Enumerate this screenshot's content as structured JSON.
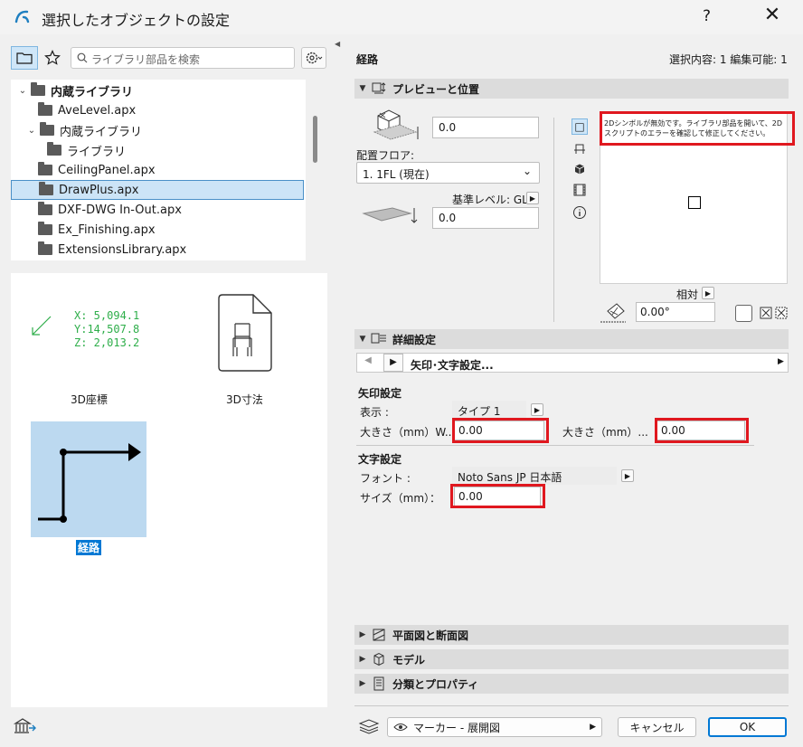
{
  "window": {
    "title": "選択したオブジェクトの設定",
    "help": "?",
    "close": "✕"
  },
  "left": {
    "search_placeholder": "ライブラリ部品を検索",
    "tree": [
      {
        "label": "内蔵ライブラリ",
        "level": 0,
        "chevron": "⌄",
        "bold": true
      },
      {
        "label": "AveLevel.apx",
        "level": 1
      },
      {
        "label": "内蔵ライブラリ",
        "level": 1,
        "chevron": "⌄"
      },
      {
        "label": "ライブラリ",
        "level": 2
      },
      {
        "label": "CeilingPanel.apx",
        "level": 1
      },
      {
        "label": "DrawPlus.apx",
        "level": 1,
        "selected": true
      },
      {
        "label": "DXF-DWG In-Out.apx",
        "level": 1
      },
      {
        "label": "Ex_Finishing.apx",
        "level": 1
      },
      {
        "label": "ExtensionsLibrary.apx",
        "level": 1
      }
    ],
    "items": [
      {
        "label": "3D座標",
        "coords": [
          "X: 5,094.1",
          "Y:14,507.8",
          "Z: 2,013.2"
        ]
      },
      {
        "label": "3D寸法"
      },
      {
        "label": "経路",
        "selected": true
      }
    ]
  },
  "right": {
    "header_title": "経路",
    "selection_info": "選択内容: 1 編集可能: 1",
    "section_preview": "プレビューと位置",
    "offset_value": "0.0",
    "floor_label": "配置フロア:",
    "floor_value": "1. 1FL (現在)",
    "ref_level_label": "基準レベル: GL",
    "ref_value": "0.0",
    "preview_message": "2Dシンボルが無効です。ライブラリ部品を開いて、2Dスクリプトのエラーを確認して修正してください。",
    "relative_label": "相対",
    "angle_value": "0.00°",
    "section_details": "詳細設定",
    "detail_nav_label": "矢印･文字設定...",
    "arrow_settings_label": "矢印設定",
    "display_label": "表示 :",
    "display_value": "タイプ 1",
    "size_w_label": "大きさ（mm）W...",
    "size_w_value": "0.00",
    "size_h_label": "大きさ（mm）...",
    "size_h_value": "0.00",
    "text_settings_label": "文字設定",
    "font_label": "フォント :",
    "font_value": "Noto Sans JP 日本語",
    "text_size_label": "サイズ（mm）：",
    "text_size_value": "0.00",
    "section_plan": "平面図と断面図",
    "section_model": "モデル",
    "section_class": "分類とプロパティ",
    "marker_value": "マーカー - 展開図",
    "cancel_label": "キャンセル",
    "ok_label": "OK"
  },
  "colors": {
    "accent": "#0078d4",
    "selection": "#cce4f7",
    "highlight_red": "#e0181f",
    "coord_green": "#2eae4a"
  }
}
